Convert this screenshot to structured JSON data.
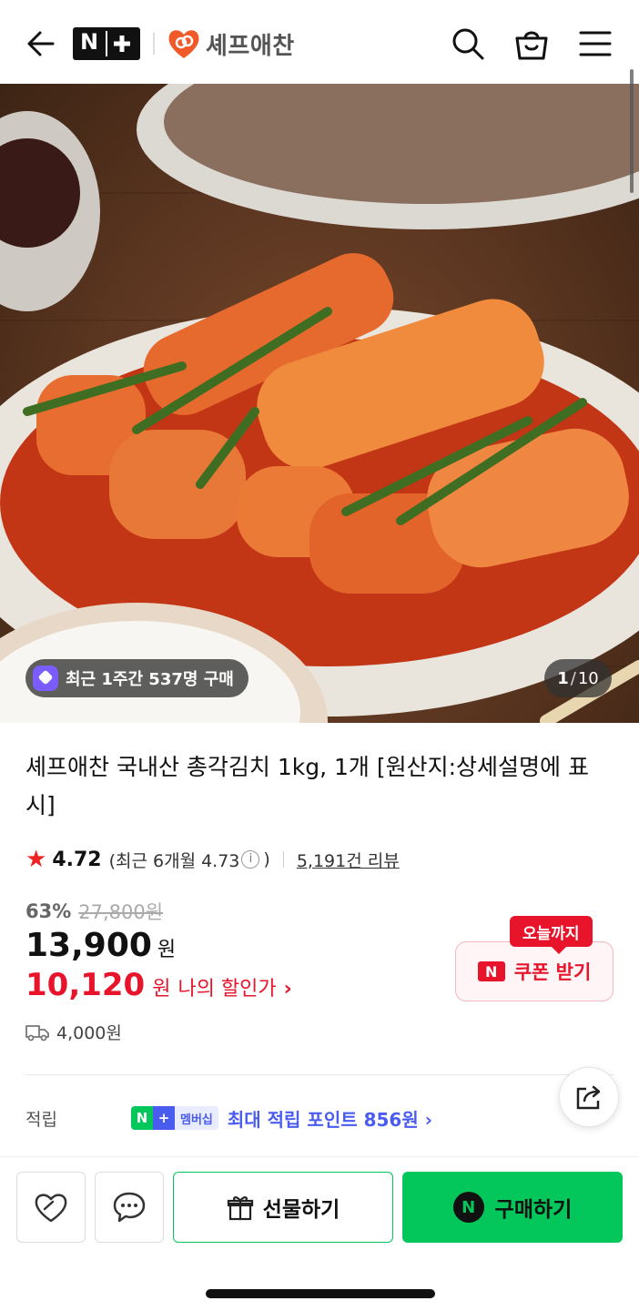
{
  "header": {
    "brand_badge": "N+",
    "brand_name": "셰프애찬",
    "icons": [
      "back-arrow-icon",
      "search-icon",
      "cart-icon",
      "menu-icon"
    ]
  },
  "hero": {
    "recent_buy_badge": "최근 1주간 537명 구매",
    "pager_current": "1",
    "pager_total": "10"
  },
  "product": {
    "title": "셰프애찬 국내산 총각김치 1kg, 1개 [원산지:상세설명에 표시]",
    "rating_score": "4.72",
    "rating_recent": "(최근 6개월 4.73",
    "rating_info_glyph": "i",
    "rating_recent_close": ")",
    "review_count": "5,191건 리뷰",
    "discount_percent": "63%",
    "original_price": "27,800원",
    "sale_price": "13,900",
    "currency": "원",
    "my_price": "10,120",
    "my_price_label": "나의 할인가",
    "chevron": "›",
    "shipping_fee": "4,000원"
  },
  "coupon": {
    "tag": "오늘까지",
    "badge": "N",
    "label": "쿠폰 받기"
  },
  "points": {
    "label": "적립",
    "badge_n": "N",
    "badge_plus": "+",
    "badge_membership": "멤버십",
    "text": "최대 적립 포인트 856원 ›"
  },
  "bottom_bar": {
    "gift_label": "선물하기",
    "buy_badge": "N",
    "buy_label": "구매하기"
  },
  "colors": {
    "naver_green": "#03c75a",
    "price_red": "#e8142b",
    "membership_blue": "#4a5cf0"
  }
}
